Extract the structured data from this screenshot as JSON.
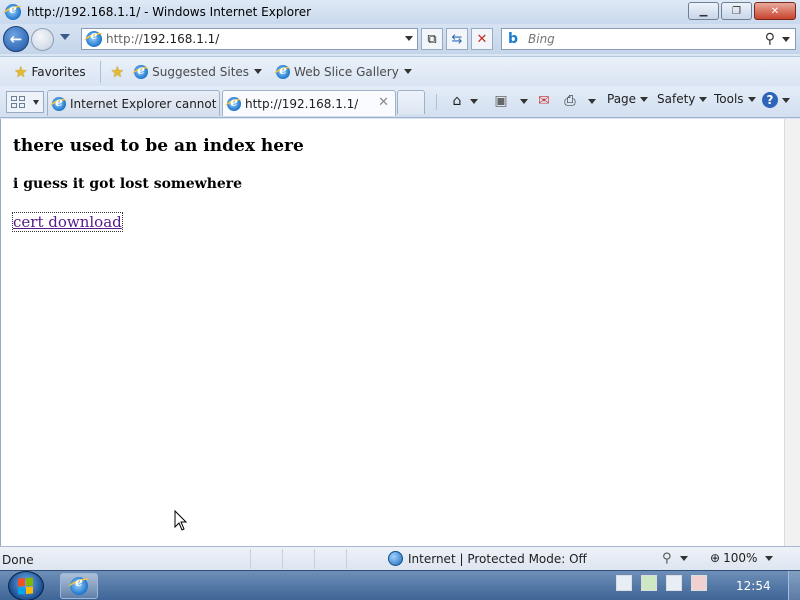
{
  "window": {
    "title": "http://192.168.1.1/ - Windows Internet Explorer",
    "buttons": [
      "minimize",
      "restore",
      "close"
    ]
  },
  "navbar": {
    "address_prefix": "http://",
    "address_host": "192.168.1.1/",
    "search_placeholder": "Bing"
  },
  "favorites_bar": {
    "favorites_label": "Favorites",
    "items": [
      {
        "label": "Suggested Sites"
      },
      {
        "label": "Web Slice Gallery"
      }
    ]
  },
  "tabs": [
    {
      "label": "Internet Explorer cannot d...",
      "active": false
    },
    {
      "label": "http://192.168.1.1/",
      "active": true
    }
  ],
  "command_bar": {
    "page_label": "Page",
    "safety_label": "Safety",
    "tools_label": "Tools"
  },
  "page": {
    "heading": "there used to be an index here",
    "subheading": "i guess it got lost somewhere",
    "link_text": "cert download"
  },
  "status_bar": {
    "status": "Done",
    "zone": "Internet | Protected Mode: Off",
    "zoom": "100%"
  },
  "taskbar": {
    "clock": "12:54"
  },
  "colors": {
    "visited_link": "#551a8b",
    "chrome_blue": "#c4d5eb"
  }
}
